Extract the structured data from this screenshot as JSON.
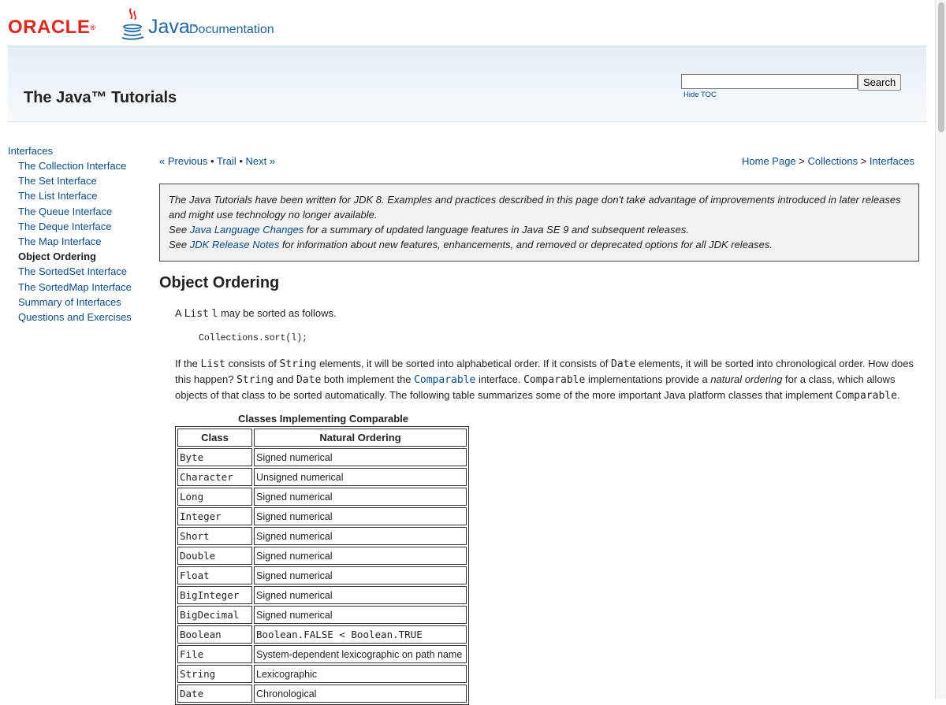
{
  "brand": {
    "oracle": "ORACLE",
    "java": "Java",
    "java_tm": "™",
    "documentation": "Documentation"
  },
  "header": {
    "title": "The Java™ Tutorials",
    "search_value": "",
    "search_button": "Search",
    "hide_toc": "Hide TOC"
  },
  "sidebar": {
    "top": "Interfaces",
    "items": [
      "The Collection Interface",
      "The Set Interface",
      "The List Interface",
      "The Queue Interface",
      "The Deque Interface",
      "The Map Interface",
      "Object Ordering",
      "The SortedSet Interface",
      "The SortedMap Interface",
      "Summary of Interfaces",
      "Questions and Exercises"
    ],
    "current_index": 6
  },
  "nav": {
    "previous": "« Previous",
    "sep": " • ",
    "trail": "Trail",
    "next": "Next »",
    "home": "Home Page",
    "gt": " > ",
    "collections": "Collections",
    "interfaces": "Interfaces"
  },
  "note": {
    "line1": "The Java Tutorials have been written for JDK 8. Examples and practices described in this page don't take advantage of improvements introduced in later releases and might use technology no longer available.",
    "see": "See ",
    "link1": "Java Language Changes",
    "line2_rest": " for a summary of updated language features in Java SE 9 and subsequent releases.",
    "link2": "JDK Release Notes",
    "line3_rest": " for information about new features, enhancements, and removed or deprecated options for all JDK releases."
  },
  "content": {
    "title": "Object Ordering",
    "p1_a": "A ",
    "p1_list": "List",
    "p1_l": "l",
    "p1_b": " may be sorted as follows.",
    "code1": "Collections.sort(l);",
    "p2": {
      "t1": "If the ",
      "c1": "List",
      "t2": " consists of ",
      "c2": "String",
      "t3": " elements, it will be sorted into alphabetical order. If it consists of ",
      "c3": "Date",
      "t4": " elements, it will be sorted into chronological order. How does this happen? ",
      "c4": "String",
      "t5": " and ",
      "c5": "Date",
      "t6": " both implement the ",
      "link": "Comparable",
      "t7": " interface. ",
      "c6": "Comparable",
      "t8": " implementations provide a ",
      "em": "natural ordering",
      "t9": " for a class, which allows objects of that class to be sorted automatically. The following table summarizes some of the more important Java platform classes that implement ",
      "c7": "Comparable",
      "t10": "."
    },
    "table": {
      "caption": "Classes Implementing Comparable",
      "headers": [
        "Class",
        "Natural Ordering"
      ],
      "rows": [
        [
          "Byte",
          "Signed numerical"
        ],
        [
          "Character",
          "Unsigned numerical"
        ],
        [
          "Long",
          "Signed numerical"
        ],
        [
          "Integer",
          "Signed numerical"
        ],
        [
          "Short",
          "Signed numerical"
        ],
        [
          "Double",
          "Signed numerical"
        ],
        [
          "Float",
          "Signed numerical"
        ],
        [
          "BigInteger",
          "Signed numerical"
        ],
        [
          "BigDecimal",
          "Signed numerical"
        ],
        [
          "Boolean",
          "Boolean.FALSE < Boolean.TRUE"
        ],
        [
          "File",
          "System-dependent lexicographic on path name"
        ],
        [
          "String",
          "Lexicographic"
        ],
        [
          "Date",
          "Chronological"
        ]
      ]
    }
  }
}
